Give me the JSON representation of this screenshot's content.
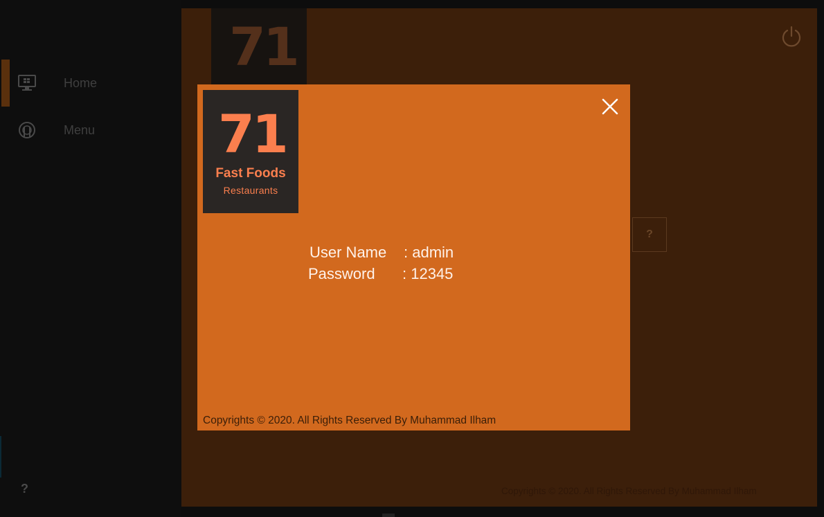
{
  "sidebar": {
    "items": [
      {
        "label": "Home",
        "icon": "monitor-icon"
      },
      {
        "label": "Menu",
        "icon": "food-icon"
      }
    ],
    "help_label": "?"
  },
  "background": {
    "logo_number": "71",
    "help_label": "?",
    "copyright": "Copyrights © 2020. All Rights Reserved By Muhammad Ilham"
  },
  "modal": {
    "logo": {
      "number": "71",
      "title": "Fast Foods",
      "subtitle": "Restaurants"
    },
    "credentials": {
      "username_label": "User Name",
      "username_value": ": admin",
      "password_label": "Password",
      "password_value": ": 12345"
    },
    "copyright": "Copyrights © 2020. All Rights Reserved By Muhammad Ilham"
  },
  "colors": {
    "accent": "#d2691e",
    "logo_text": "#fb7f4e",
    "background_panel": "#3c1f0a"
  }
}
